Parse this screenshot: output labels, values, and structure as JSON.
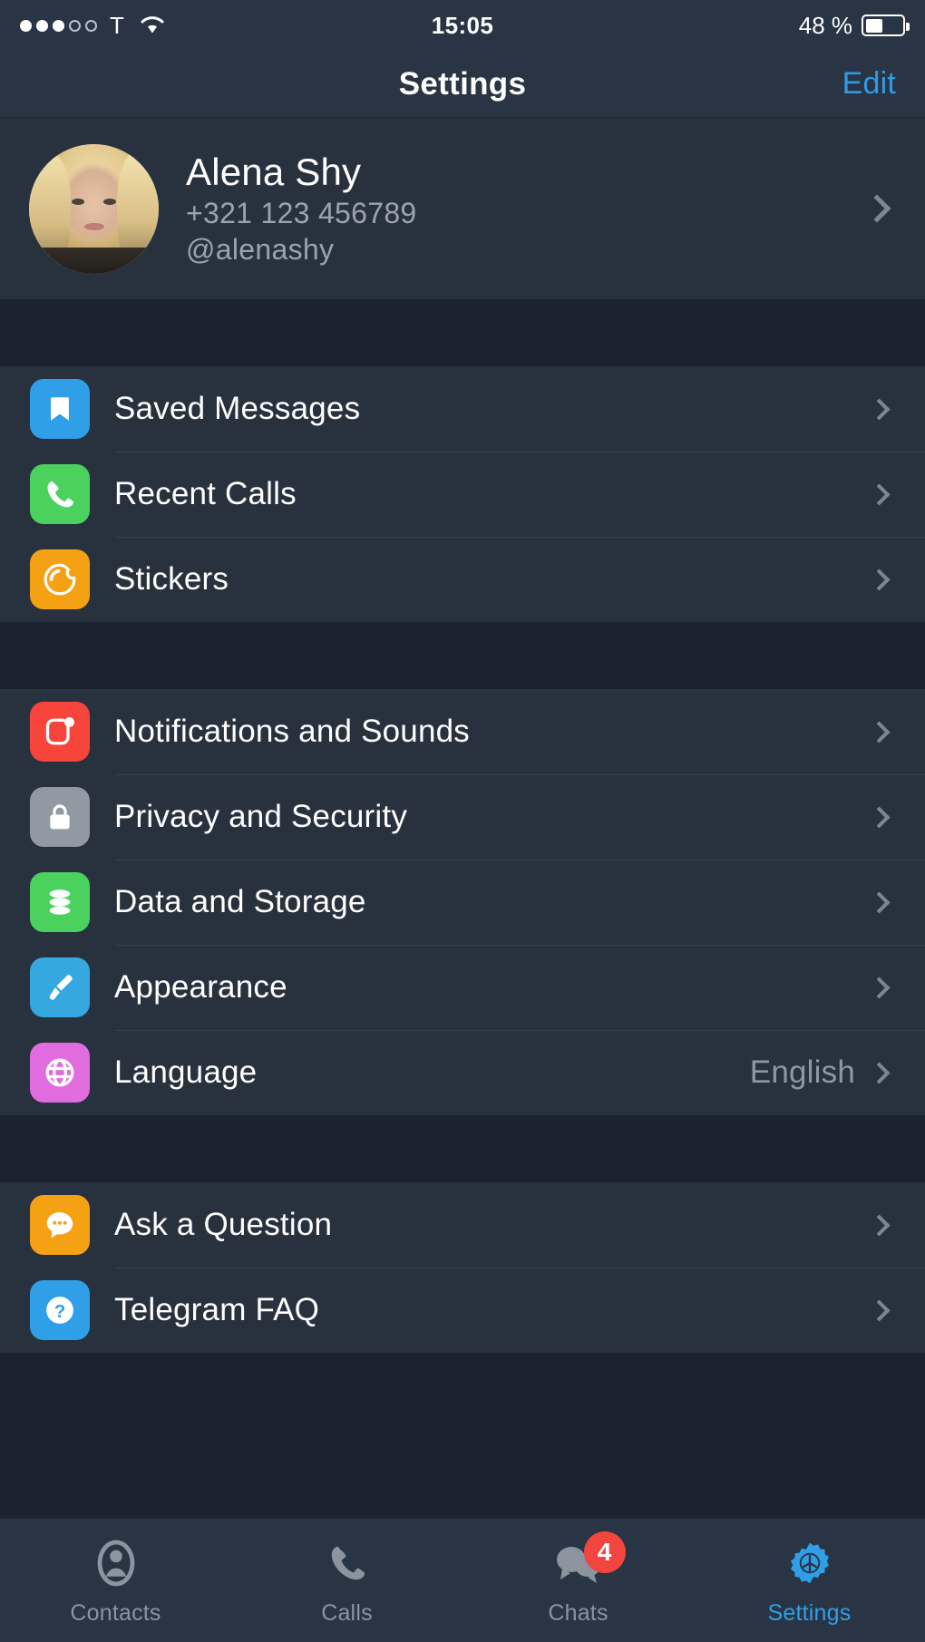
{
  "status_bar": {
    "signal_dots_filled": 3,
    "signal_dots_total": 5,
    "carrier": "T",
    "time": "15:05",
    "battery_percent": "48 %",
    "battery_level": 48
  },
  "nav": {
    "title": "Settings",
    "edit_label": "Edit"
  },
  "profile": {
    "name": "Alena Shy",
    "phone": "+321 123 456789",
    "username": "@alenashy"
  },
  "groups": [
    {
      "rows": [
        {
          "label": "Saved Messages",
          "icon": "bookmark-icon",
          "color": "#2f9fe8",
          "value": ""
        },
        {
          "label": "Recent Calls",
          "icon": "phone-icon",
          "color": "#4ad15e",
          "value": ""
        },
        {
          "label": "Stickers",
          "icon": "sticker-icon",
          "color": "#f5a114",
          "value": ""
        }
      ]
    },
    {
      "rows": [
        {
          "label": "Notifications and Sounds",
          "icon": "notification-icon",
          "color": "#f7453c",
          "value": ""
        },
        {
          "label": "Privacy and Security",
          "icon": "lock-icon",
          "color": "#9199a3",
          "value": ""
        },
        {
          "label": "Data and Storage",
          "icon": "database-icon",
          "color": "#4ad15e",
          "value": ""
        },
        {
          "label": "Appearance",
          "icon": "paintbrush-icon",
          "color": "#35a8e0",
          "value": ""
        },
        {
          "label": "Language",
          "icon": "globe-icon",
          "color": "#e06ce0",
          "value": "English"
        }
      ]
    },
    {
      "rows": [
        {
          "label": "Ask a Question",
          "icon": "chat-bubble-icon",
          "color": "#f5a114",
          "value": ""
        },
        {
          "label": "Telegram FAQ",
          "icon": "question-circle-icon",
          "color": "#2f9fe8",
          "value": ""
        }
      ]
    }
  ],
  "tabs": [
    {
      "label": "Contacts",
      "icon": "contacts-icon",
      "active": false,
      "badge": ""
    },
    {
      "label": "Calls",
      "icon": "calls-icon",
      "active": false,
      "badge": ""
    },
    {
      "label": "Chats",
      "icon": "chats-icon",
      "active": false,
      "badge": "4"
    },
    {
      "label": "Settings",
      "icon": "settings-gear-icon",
      "active": true,
      "badge": ""
    }
  ],
  "colors": {
    "accent": "#2f9fe8",
    "row_background": "#28323f",
    "page_background": "#1b2330",
    "bar_background": "#293544",
    "badge_red": "#f2453d",
    "secondary_text": "#8e97a2"
  }
}
